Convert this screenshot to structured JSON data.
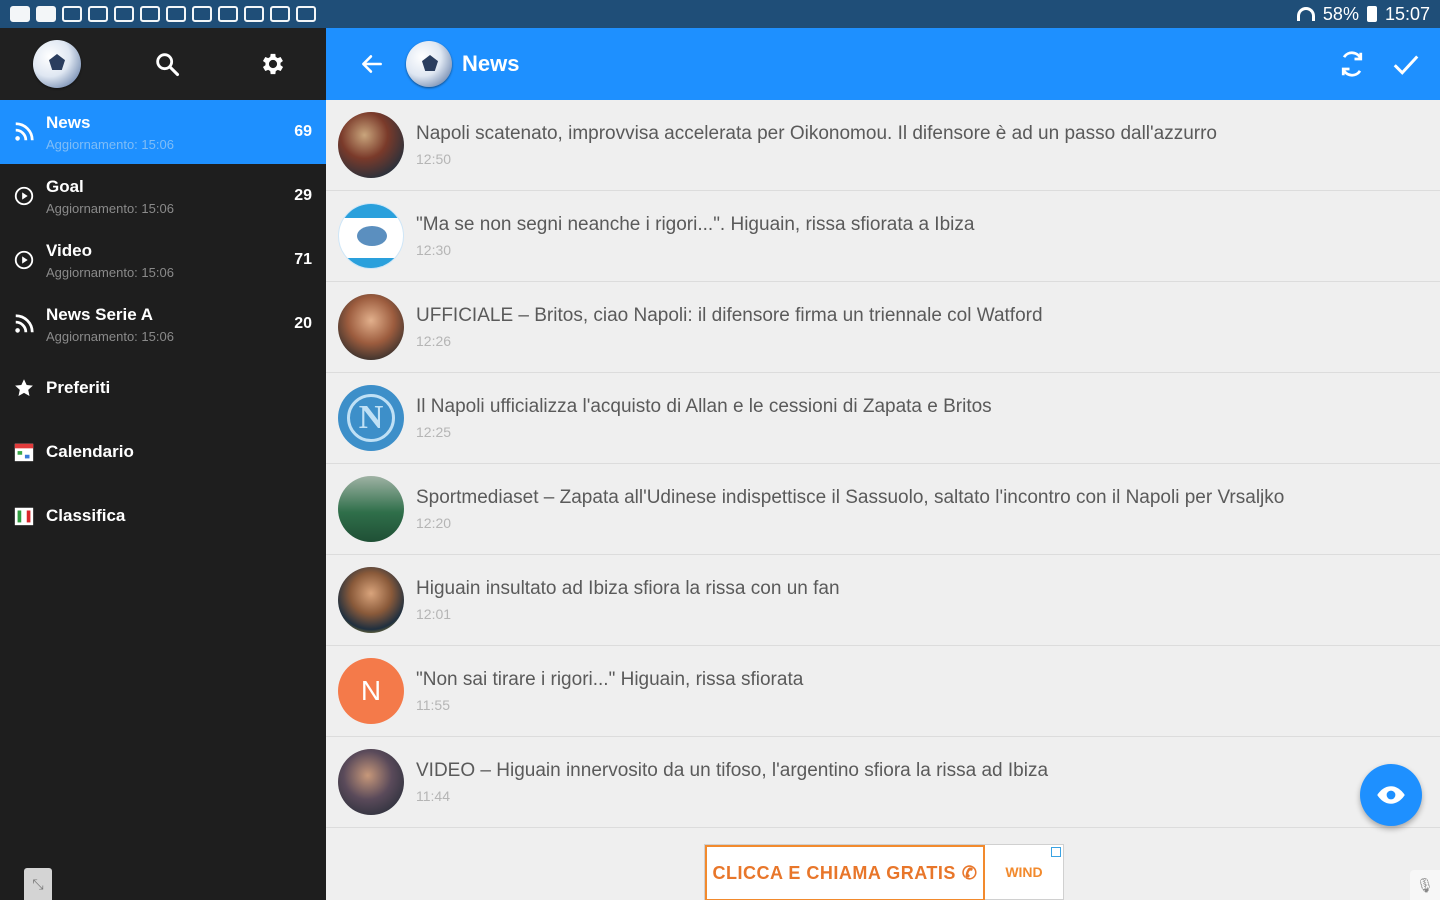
{
  "status_bar": {
    "battery": "58%",
    "time": "15:07"
  },
  "app": {
    "title": "News"
  },
  "sidebar": {
    "items": [
      {
        "label": "News",
        "sub": "Aggiornamento: 15:06",
        "count": "69",
        "icon": "rss-icon",
        "active": true
      },
      {
        "label": "Goal",
        "sub": "Aggiornamento: 15:06",
        "count": "29",
        "icon": "play-circle-icon"
      },
      {
        "label": "Video",
        "sub": "Aggiornamento: 15:06",
        "count": "71",
        "icon": "play-circle-icon"
      },
      {
        "label": "News Serie A",
        "sub": "Aggiornamento: 15:06",
        "count": "20",
        "icon": "rss-icon"
      },
      {
        "label": "Preferiti",
        "icon": "star-icon"
      },
      {
        "label": "Calendario",
        "icon": "calendar-icon"
      },
      {
        "label": "Classifica",
        "icon": "flag-icon"
      }
    ]
  },
  "news": [
    {
      "title": "Napoli scatenato, improvvisa accelerata per Oikonomou. Il difensore è ad un passo dall'azzurro",
      "time": "12:50",
      "thumb": "photo"
    },
    {
      "title": "\"Ma se non segni neanche i rigori...\". Higuain, rissa sfiorata a Ibiza",
      "time": "12:30",
      "thumb": "logo"
    },
    {
      "title": "UFFICIALE – Britos, ciao Napoli: il difensore firma un triennale col Watford",
      "time": "12:26",
      "thumb": "photo"
    },
    {
      "title": "Il Napoli ufficializza l'acquisto di Allan e le cessioni di Zapata e Britos",
      "time": "12:25",
      "thumb": "napoli"
    },
    {
      "title": "Sportmediaset – Zapata all'Udinese indispettisce il Sassuolo, saltato l'incontro con il Napoli per Vrsaljko",
      "time": "12:20",
      "thumb": "photo"
    },
    {
      "title": "Higuain insultato ad Ibiza sfiora la rissa con un fan",
      "time": "12:01",
      "thumb": "photo"
    },
    {
      "title": "\"Non sai tirare i rigori...\" Higuain, rissa sfiorata",
      "time": "11:55",
      "thumb": "letter",
      "letter": "N"
    },
    {
      "title": "VIDEO – Higuain innervosito da un tifoso, l'argentino sfiora la rissa ad Ibiza",
      "time": "11:44",
      "thumb": "photo"
    }
  ],
  "ad": {
    "text": "CLICCA E CHIAMA GRATIS",
    "brand": "WIND"
  },
  "colors": {
    "accent": "#1e90ff",
    "sidebar_bg": "#1e1e1e",
    "status_bar": "#1f4e78"
  }
}
